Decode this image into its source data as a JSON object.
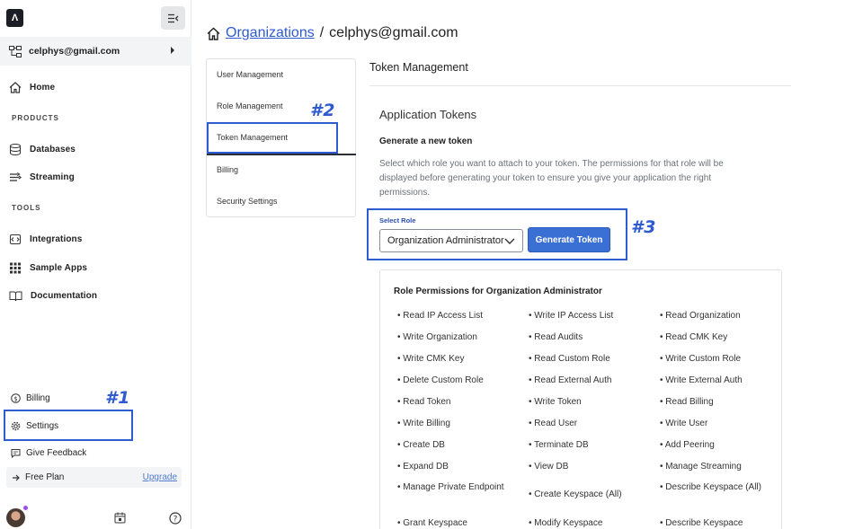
{
  "sidebar": {
    "logo_text": "Λ",
    "org_email": "celphys@gmail.com",
    "home": "Home",
    "products_label": "PRODUCTS",
    "databases": "Databases",
    "streaming": "Streaming",
    "tools_label": "TOOLS",
    "integrations": "Integrations",
    "sample_apps": "Sample Apps",
    "documentation": "Documentation",
    "billing": "Billing",
    "settings": "Settings",
    "give_feedback": "Give Feedback",
    "free_plan": "Free Plan",
    "upgrade": "Upgrade"
  },
  "annotations": {
    "one": "#1",
    "two": "#2",
    "three": "#3"
  },
  "breadcrumb": {
    "link": "Organizations",
    "separator": "/",
    "current": "celphys@gmail.com"
  },
  "subnav": {
    "items": [
      "User Management",
      "Role Management",
      "Token Management",
      "Billing",
      "Security Settings"
    ],
    "active": "Token Management"
  },
  "panel": {
    "title": "Token Management",
    "section_title": "Application Tokens",
    "generate_heading": "Generate a new token",
    "description": "Select which role you want to attach to your token. The permissions for that role will be displayed before generating your token to ensure you give your application the right permissions.",
    "select_label": "Select Role",
    "selected_role": "Organization Administrator",
    "generate_button": "Generate Token"
  },
  "permissions": {
    "title": "Role Permissions for Organization Administrator",
    "items": [
      "Read IP Access List",
      "Write IP Access List",
      "Read Organization",
      "Write Organization",
      "Read Audits",
      "Read CMK Key",
      "Write CMK Key",
      "Read Custom Role",
      "Write Custom Role",
      "Delete Custom Role",
      "Read External Auth",
      "Write External Auth",
      "Read Token",
      "Write Token",
      "Read Billing",
      "Write Billing",
      "Read User",
      "Write User",
      "Create DB",
      "Terminate DB",
      "Add Peering",
      "Expand DB",
      "View DB",
      "Manage Streaming",
      "Manage Private Endpoint",
      "Create Keyspace (All)",
      "Describe Keyspace (All)",
      "Grant Keyspace",
      "Modify Keyspace",
      "Describe Keyspace"
    ]
  },
  "colors": {
    "accent": "#2f5bd1",
    "button": "#3a6fd4",
    "annotation": "#2f5bd1"
  }
}
